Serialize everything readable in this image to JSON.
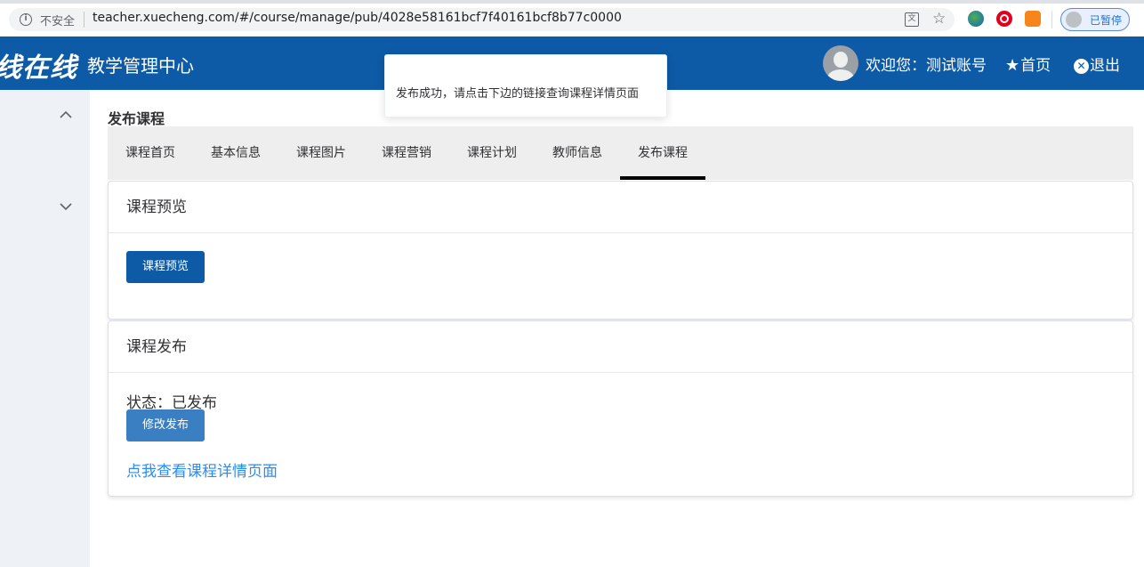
{
  "browser": {
    "insecure_label": "不安全",
    "url": "teacher.xuecheng.com/#/course/manage/pub/4028e58161bcf7f40161bcf8b77c0000",
    "profile_label": "已暂停"
  },
  "header": {
    "logo": "线在线",
    "title": "教学管理中心",
    "welcome": "欢迎您：测试账号",
    "home_label": "首页",
    "logout_label": "退出"
  },
  "toast": {
    "message": "发布成功，请点击下边的链接查询课程详情页面"
  },
  "page": {
    "title": "发布课程"
  },
  "tabs": [
    {
      "label": "课程首页"
    },
    {
      "label": "基本信息"
    },
    {
      "label": "课程图片"
    },
    {
      "label": "课程营销"
    },
    {
      "label": "课程计划"
    },
    {
      "label": "教师信息"
    },
    {
      "label": "发布课程",
      "active": true
    }
  ],
  "preview_card": {
    "title": "课程预览",
    "button_label": "课程预览"
  },
  "publish_card": {
    "title": "课程发布",
    "status_text": "状态：已发布",
    "button_label": "修改发布",
    "detail_link": "点我查看课程详情页面"
  },
  "colors": {
    "header_bg": "#0d5aa7",
    "primary_button": "#0d5aa7",
    "secondary_button": "#3a7fc1",
    "link": "#2d8cf0",
    "tab_active_indicator": "#000000"
  }
}
